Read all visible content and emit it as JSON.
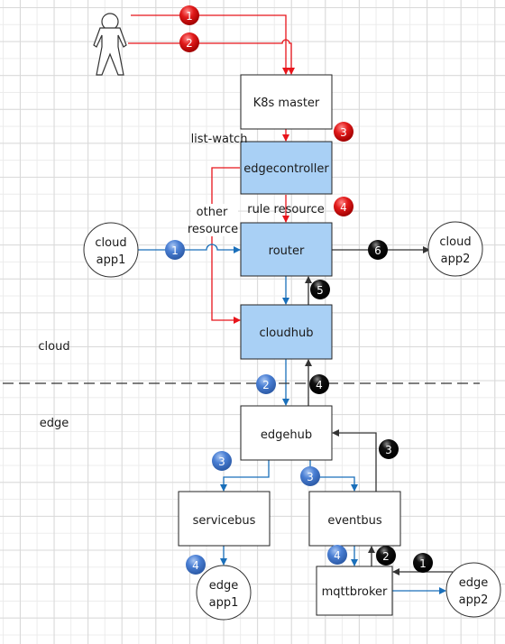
{
  "colors": {
    "red": "#e8141b",
    "blue": "#1a6fba",
    "black": "#333333",
    "box_fill_blue": "#a9d0f5",
    "badge_red": "#e21b1b",
    "badge_blue": "#4a7fd4",
    "badge_black": "#0a0a0a"
  },
  "boxes": {
    "k8s_master": "K8s master",
    "edgecontroller": "edgecontroller",
    "router": "router",
    "cloudhub": "cloudhub",
    "edgehub": "edgehub",
    "servicebus": "servicebus",
    "eventbus": "eventbus",
    "mqttbroker": "mqttbroker"
  },
  "circles": {
    "cloud_app1": [
      "cloud",
      "app1"
    ],
    "cloud_app2": [
      "cloud",
      "app2"
    ],
    "edge_app1": [
      "edge",
      "app1"
    ],
    "edge_app2": [
      "edge",
      "app2"
    ]
  },
  "labels": {
    "list_watch": "list-watch",
    "other_resource": [
      "other",
      "resource"
    ],
    "rule_resource": "rule resource",
    "cloud_zone": "cloud",
    "edge_zone": "edge"
  },
  "badges": {
    "red": [
      "1",
      "2",
      "3",
      "4"
    ],
    "blue": [
      "1",
      "2",
      "3",
      "3",
      "4",
      "4"
    ],
    "black": [
      "1",
      "2",
      "3",
      "4",
      "5",
      "6"
    ]
  }
}
